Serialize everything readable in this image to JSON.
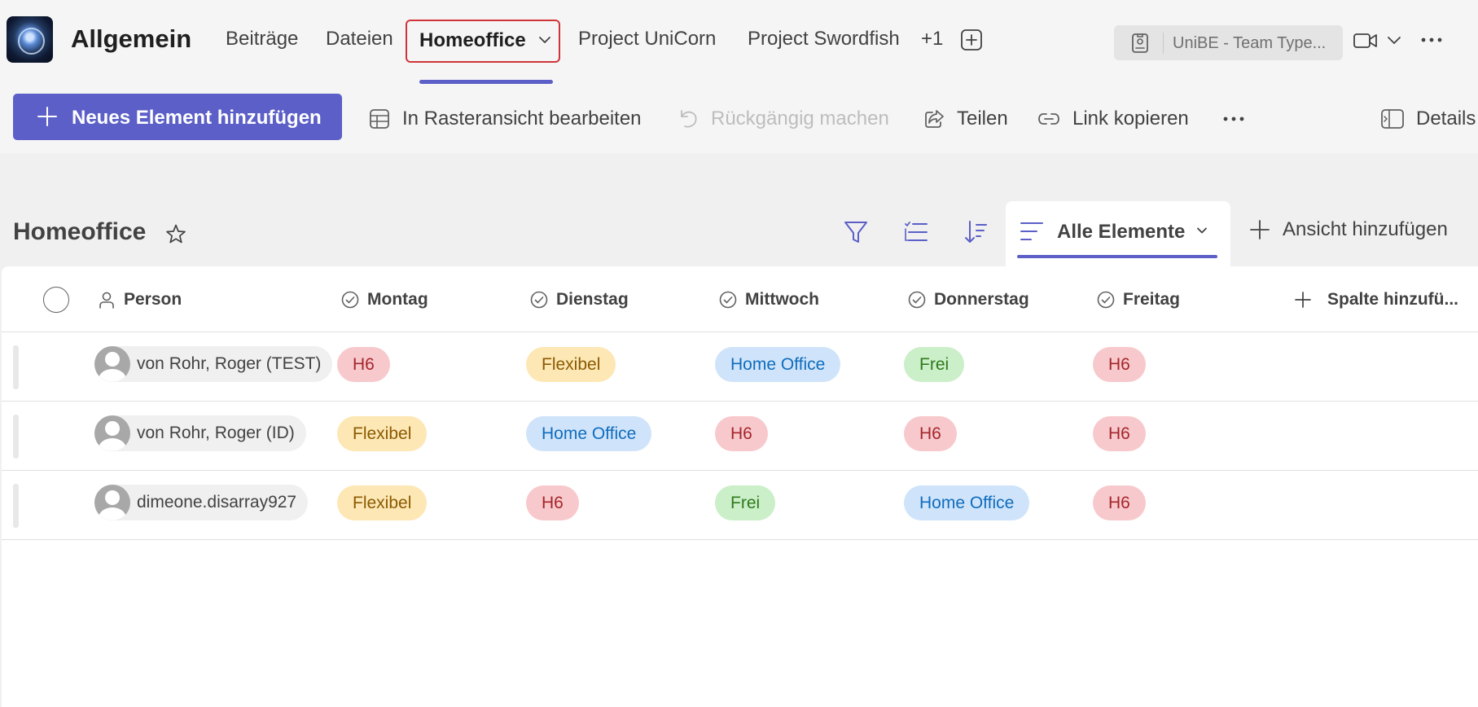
{
  "header": {
    "channel_title": "Allgemein",
    "tabs": [
      {
        "label": "Beiträge"
      },
      {
        "label": "Dateien"
      },
      {
        "label": "Homeoffice"
      },
      {
        "label": "Project UniCorn"
      },
      {
        "label": "Project Swordfish"
      }
    ],
    "overflow_count": "+1",
    "team_pill": "UniBE - Team Type..."
  },
  "commandbar": {
    "new_item": "Neues Element hinzufügen",
    "grid_edit": "In Rasteransicht bearbeiten",
    "undo": "Rückgängig machen",
    "share": "Teilen",
    "copy_link": "Link kopieren",
    "details": "Details"
  },
  "view": {
    "title": "Homeoffice",
    "current_view": "Alle Elemente",
    "add_view": "Ansicht hinzufügen"
  },
  "table": {
    "columns": [
      "Person",
      "Montag",
      "Dienstag",
      "Mittwoch",
      "Donnerstag",
      "Freitag"
    ],
    "add_column": "Spalte hinzufü...",
    "rows": [
      {
        "person": "von Rohr, Roger (TEST)",
        "cells": [
          "H6",
          "Flexibel",
          "Home Office",
          "Frei",
          "H6"
        ]
      },
      {
        "person": "von Rohr, Roger (ID)",
        "cells": [
          "Flexibel",
          "Home Office",
          "H6",
          "H6",
          "H6"
        ]
      },
      {
        "person": "dimeone.disarray927",
        "cells": [
          "Flexibel",
          "H6",
          "Frei",
          "Home Office",
          "H6"
        ]
      }
    ]
  },
  "colors": {
    "accent": "#5b5fc7",
    "highlight_border": "#d13438",
    "tag_h6": "#f8c9cc",
    "tag_flexibel": "#fde7b4",
    "tag_home_office": "#cfe4fa",
    "tag_frei": "#cbefc8"
  },
  "icons": {
    "tab_chevron": "chevron-down-icon",
    "add_tab": "add-tab-icon",
    "team_pill": "id-badge-icon",
    "video": "video-camera-icon",
    "more": "more-horizontal-icon",
    "grid": "grid-icon",
    "undo": "undo-icon",
    "share": "share-icon",
    "link": "link-icon",
    "details": "details-pane-icon",
    "favorite": "star-icon",
    "filter": "filter-icon",
    "group": "group-list-icon",
    "sort": "sort-icon",
    "view": "list-view-icon",
    "person_column": "person-icon",
    "choice_column": "check-circle-icon"
  }
}
